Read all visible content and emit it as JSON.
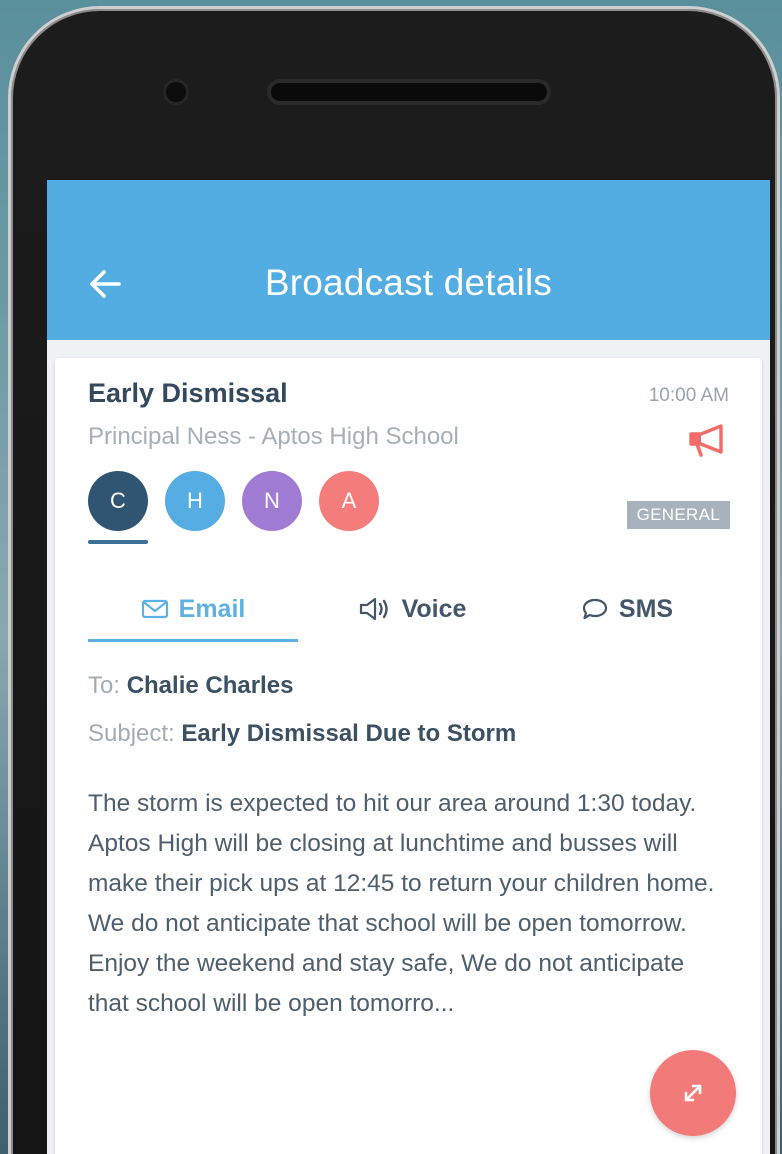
{
  "header": {
    "title": "Broadcast details",
    "back_icon": "back-arrow-icon"
  },
  "broadcast": {
    "title": "Early Dismissal",
    "time": "10:00 AM",
    "sender": "Principal Ness - Aptos High School",
    "type_icon": "megaphone-icon",
    "category": "GENERAL",
    "recipients": [
      {
        "initial": "C",
        "color": "#2f5573",
        "selected": true
      },
      {
        "initial": "H",
        "color": "#55ade4",
        "selected": false
      },
      {
        "initial": "N",
        "color": "#a07bd4",
        "selected": false
      },
      {
        "initial": "A",
        "color": "#f47c7a",
        "selected": false
      }
    ]
  },
  "tabs": {
    "email": "Email",
    "voice": "Voice",
    "sms": "SMS",
    "active": "Email"
  },
  "message": {
    "to_label": "To:",
    "to_value": "Chalie Charles",
    "subject_label": "Subject:",
    "subject_value": "Early Dismissal Due to Storm",
    "body": "The storm is expected to hit our area around 1:30 today. Aptos High will be closing at lunchtime and busses will make their pick ups at 12:45 to return your children home. We do not anticipate that school will be open tomorrow.\nEnjoy the weekend and stay safe, We do not anticipate that school will be open tomorro..."
  },
  "fab": {
    "icon": "expand-icon",
    "color": "#f27a78"
  },
  "colors": {
    "appbar": "#53ade3",
    "accent": "#5fb1e3",
    "alert": "#f26d6a"
  }
}
